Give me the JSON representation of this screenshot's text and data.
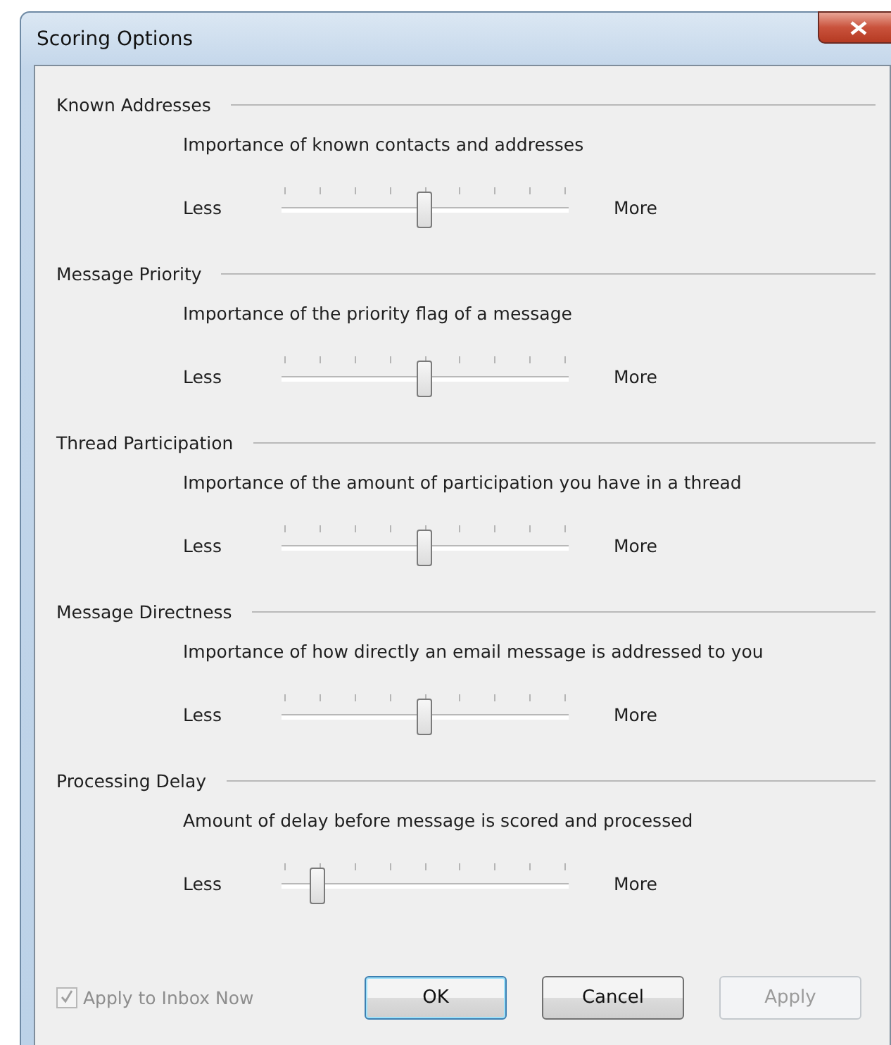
{
  "window": {
    "title": "Scoring Options"
  },
  "groups": [
    {
      "title": "Known Addresses",
      "description": "Importance of known contacts and addresses",
      "min_label": "Less",
      "max_label": "More",
      "level": 0.5
    },
    {
      "title": "Message Priority",
      "description": "Importance of the priority flag of a message",
      "min_label": "Less",
      "max_label": "More",
      "level": 0.5
    },
    {
      "title": "Thread Participation",
      "description": "Importance of the amount of participation you have in a thread",
      "min_label": "Less",
      "max_label": "More",
      "level": 0.5
    },
    {
      "title": "Message Directness",
      "description": "Importance of how directly an email message is addressed to you",
      "min_label": "Less",
      "max_label": "More",
      "level": 0.5
    },
    {
      "title": "Processing Delay",
      "description": "Amount of delay before message is scored and processed",
      "min_label": "Less",
      "max_label": "More",
      "level": 0.125
    }
  ],
  "apply_checkbox": {
    "label": "Apply to Inbox Now",
    "checked": true,
    "disabled": true
  },
  "buttons": [
    {
      "label": "OK",
      "focused": true,
      "disabled": false
    },
    {
      "label": "Cancel",
      "focused": false,
      "disabled": false
    },
    {
      "label": "Apply",
      "focused": false,
      "disabled": true
    }
  ]
}
